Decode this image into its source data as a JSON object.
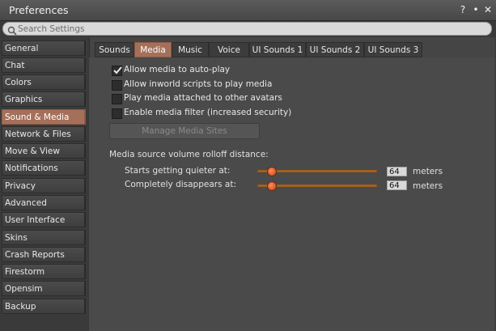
{
  "window": {
    "title": "Preferences",
    "help_glyph": "?",
    "minimize_glyph": "•",
    "close_glyph": "✕"
  },
  "search": {
    "placeholder": "Search Settings",
    "value": ""
  },
  "sidebar": {
    "items": [
      {
        "label": "General"
      },
      {
        "label": "Chat"
      },
      {
        "label": "Colors"
      },
      {
        "label": "Graphics"
      },
      {
        "label": "Sound & Media"
      },
      {
        "label": "Network & Files"
      },
      {
        "label": "Move & View"
      },
      {
        "label": "Notifications"
      },
      {
        "label": "Privacy"
      },
      {
        "label": "Advanced"
      },
      {
        "label": "User Interface"
      },
      {
        "label": "Skins"
      },
      {
        "label": "Crash Reports"
      },
      {
        "label": "Firestorm"
      },
      {
        "label": "Opensim"
      },
      {
        "label": "Backup"
      }
    ],
    "active_index": 4
  },
  "tabs": {
    "items": [
      {
        "label": "Sounds"
      },
      {
        "label": "Media"
      },
      {
        "label": "Music"
      },
      {
        "label": "Voice"
      },
      {
        "label": "UI Sounds 1"
      },
      {
        "label": "UI Sounds 2"
      },
      {
        "label": "UI Sounds 3"
      }
    ],
    "active_index": 1
  },
  "media": {
    "checkboxes": [
      {
        "label": "Allow media to auto-play",
        "checked": true
      },
      {
        "label": "Allow inworld scripts to play media",
        "checked": false
      },
      {
        "label": "Play media attached to other avatars",
        "checked": false
      },
      {
        "label": "Enable media filter (increased security)",
        "checked": false
      }
    ],
    "manage_button": "Manage Media Sites",
    "rolloff_label": "Media source volume rolloff distance:",
    "sliders": [
      {
        "label": "Starts getting quieter at:",
        "value": "64",
        "unit": "meters"
      },
      {
        "label": "Completely disappears at:",
        "value": "64",
        "unit": "meters"
      }
    ]
  },
  "colors": {
    "accent": "#a5705a",
    "slider": "#b26a1f"
  }
}
